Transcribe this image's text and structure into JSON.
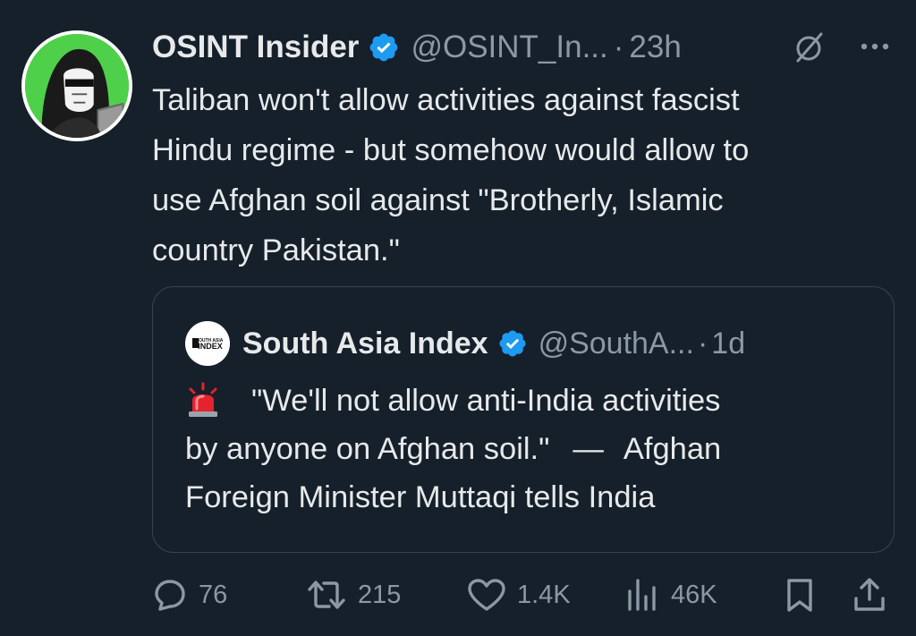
{
  "tweet": {
    "author": {
      "display_name": "OSINT Insider",
      "handle": "@OSINT_In...",
      "verified": true,
      "avatar_icon": "hooded-figure-avatar"
    },
    "separator": "·",
    "time": "23h",
    "lines": [
      "Taliban won't allow activities against fascist",
      "Hindu regime - but somehow would allow to",
      "use Afghan soil against \"Brotherly, Islamic",
      "country Pakistan.\""
    ],
    "quoted": {
      "avatar_text_top": "SOUTH ASIA",
      "avatar_text_bottom": "INDEX",
      "display_name": "South Asia Index",
      "handle": "@SouthA...",
      "separator": "·",
      "time": "1d",
      "emoji_icon": "police-siren-icon",
      "line1": "\"We'll not allow anti-India activities",
      "line2_a": "by anyone on Afghan soil.\"",
      "line2_dash": "—",
      "line2_b": "Afghan",
      "line3": "Foreign Minister Muttaqi tells India"
    },
    "actions": {
      "replies": "76",
      "reposts": "215",
      "likes": "1.4K",
      "views": "46K"
    }
  },
  "colors": {
    "background": "#15202b",
    "text_primary": "#e7e9ea",
    "text_secondary": "#8b98a5",
    "verified_blue": "#1d9bf0",
    "border": "#38444d",
    "avatar_green": "#4fd04a"
  }
}
